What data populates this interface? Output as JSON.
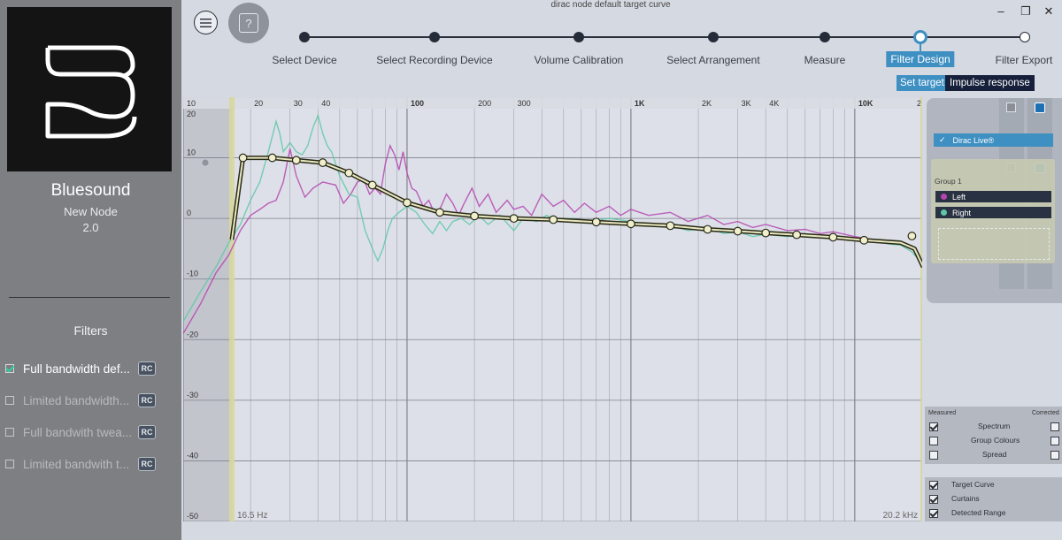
{
  "window": {
    "title": "dirac node default target curve",
    "minimize": "–",
    "restore": "❐",
    "close": "✕"
  },
  "header": {
    "help_symbol": "?",
    "menu_icon": "hamburger-icon"
  },
  "device": {
    "name": "Bluesound",
    "model": "New Node",
    "version": "2.0"
  },
  "filters": {
    "title": "Filters",
    "items": [
      {
        "label": "Full bandwidth def...",
        "checked": true,
        "badge": "RC"
      },
      {
        "label": "Limited bandwidth...",
        "checked": false,
        "badge": "RC"
      },
      {
        "label": "Full bandwith twea...",
        "checked": false,
        "badge": "RC"
      },
      {
        "label": "Limited bandwith t...",
        "checked": false,
        "badge": "RC"
      }
    ]
  },
  "wizard": {
    "steps": [
      {
        "label": "Select Device",
        "state": "done"
      },
      {
        "label": "Select Recording Device",
        "state": "done"
      },
      {
        "label": "Volume Calibration",
        "state": "done"
      },
      {
        "label": "Select Arrangement",
        "state": "done"
      },
      {
        "label": "Measure",
        "state": "done"
      },
      {
        "label": "Filter Design",
        "state": "current"
      },
      {
        "label": "Filter Export",
        "state": "future"
      }
    ]
  },
  "tabs": {
    "set_target": "Set target",
    "impulse_response": "Impulse response"
  },
  "chart_data": {
    "type": "line",
    "xscale": "log",
    "xlim": [
      10,
      20000
    ],
    "ylim": [
      -50,
      20
    ],
    "x_ticks": [
      {
        "value": 10,
        "label": "10"
      },
      {
        "value": 20,
        "label": "20"
      },
      {
        "value": 30,
        "label": "30"
      },
      {
        "value": 40,
        "label": "40"
      },
      {
        "value": 100,
        "label": "100"
      },
      {
        "value": 200,
        "label": "200"
      },
      {
        "value": 300,
        "label": "300"
      },
      {
        "value": 1000,
        "label": "1K"
      },
      {
        "value": 2000,
        "label": "2K"
      },
      {
        "value": 3000,
        "label": "3K"
      },
      {
        "value": 4000,
        "label": "4K"
      },
      {
        "value": 10000,
        "label": "10K"
      },
      {
        "value": 20000,
        "label": "2"
      }
    ],
    "y_ticks": [
      20,
      10,
      0,
      -10,
      -20,
      -30,
      -40,
      -50
    ],
    "curtains": {
      "low_hz": 16.5,
      "high_hz": 20200,
      "low_label": "16.5 Hz",
      "high_label": "20.2 kHz"
    },
    "target_curve": {
      "name": "Target Curve",
      "color": "#2a2a18",
      "points": [
        [
          16.5,
          -3.5
        ],
        [
          18.5,
          10
        ],
        [
          25,
          10
        ],
        [
          32,
          9.6
        ],
        [
          42,
          9.2
        ],
        [
          55,
          7.5
        ],
        [
          70,
          5.5
        ],
        [
          100,
          2.6
        ],
        [
          140,
          1.0
        ],
        [
          200,
          0.4
        ],
        [
          300,
          0.0
        ],
        [
          450,
          -0.2
        ],
        [
          700,
          -0.6
        ],
        [
          1000,
          -0.9
        ],
        [
          1500,
          -1.2
        ],
        [
          2200,
          -1.8
        ],
        [
          3000,
          -2.1
        ],
        [
          4000,
          -2.4
        ],
        [
          5500,
          -2.7
        ],
        [
          8000,
          -3.1
        ],
        [
          11000,
          -3.6
        ],
        [
          16000,
          -4.0
        ],
        [
          18500,
          -5.0
        ],
        [
          20200,
          -8
        ]
      ],
      "handles": [
        [
          18.5,
          10
        ],
        [
          25,
          10
        ],
        [
          32,
          9.6
        ],
        [
          42,
          9.2
        ],
        [
          55,
          7.5
        ],
        [
          70,
          5.5
        ],
        [
          100,
          2.6
        ],
        [
          140,
          1.0
        ],
        [
          200,
          0.4
        ],
        [
          300,
          0.0
        ],
        [
          450,
          -0.2
        ],
        [
          700,
          -0.6
        ],
        [
          1000,
          -0.9
        ],
        [
          1500,
          -1.2
        ],
        [
          2200,
          -1.8
        ],
        [
          3000,
          -2.1
        ],
        [
          4000,
          -2.4
        ],
        [
          5500,
          -2.7
        ],
        [
          8000,
          -3.1
        ],
        [
          11000,
          -3.6
        ],
        [
          18000,
          -2.9
        ]
      ]
    },
    "series": [
      {
        "name": "Left",
        "color": "#b545b0",
        "points": [
          [
            10,
            -19
          ],
          [
            12,
            -14
          ],
          [
            14,
            -9
          ],
          [
            16,
            -6
          ],
          [
            18,
            -2
          ],
          [
            20,
            0.5
          ],
          [
            22,
            1.5
          ],
          [
            24,
            2.5
          ],
          [
            26,
            3
          ],
          [
            28,
            6
          ],
          [
            30,
            11.5
          ],
          [
            32,
            7
          ],
          [
            35,
            3.5
          ],
          [
            38,
            5
          ],
          [
            42,
            6
          ],
          [
            48,
            5.5
          ],
          [
            52,
            2.5
          ],
          [
            56,
            4
          ],
          [
            60,
            6
          ],
          [
            64,
            6.5
          ],
          [
            68,
            4
          ],
          [
            72,
            5
          ],
          [
            76,
            4
          ],
          [
            80,
            9
          ],
          [
            84,
            12
          ],
          [
            88,
            10.5
          ],
          [
            92,
            8
          ],
          [
            96,
            11
          ],
          [
            100,
            7.5
          ],
          [
            105,
            5
          ],
          [
            110,
            4.5
          ],
          [
            118,
            2
          ],
          [
            125,
            3
          ],
          [
            132,
            1
          ],
          [
            140,
            1.5
          ],
          [
            150,
            4
          ],
          [
            160,
            2.5
          ],
          [
            170,
            0.5
          ],
          [
            180,
            2.5
          ],
          [
            195,
            5
          ],
          [
            210,
            2
          ],
          [
            230,
            4
          ],
          [
            250,
            1
          ],
          [
            280,
            3
          ],
          [
            300,
            1.5
          ],
          [
            330,
            2
          ],
          [
            360,
            0.5
          ],
          [
            400,
            4
          ],
          [
            450,
            2
          ],
          [
            500,
            3
          ],
          [
            560,
            1
          ],
          [
            620,
            2.5
          ],
          [
            700,
            1
          ],
          [
            800,
            2
          ],
          [
            900,
            0.5
          ],
          [
            1000,
            1.5
          ],
          [
            1200,
            0.5
          ],
          [
            1500,
            1
          ],
          [
            1800,
            -0.5
          ],
          [
            2200,
            0.5
          ],
          [
            2600,
            -1
          ],
          [
            3000,
            -0.5
          ],
          [
            3500,
            -1.5
          ],
          [
            4000,
            -1
          ],
          [
            5000,
            -2
          ],
          [
            6000,
            -1.8
          ],
          [
            7000,
            -2.5
          ],
          [
            8000,
            -2.2
          ],
          [
            10000,
            -3
          ],
          [
            12000,
            -3.5
          ],
          [
            14000,
            -4
          ],
          [
            16000,
            -4.3
          ],
          [
            18000,
            -5
          ],
          [
            20000,
            -7
          ]
        ]
      },
      {
        "name": "Right",
        "color": "#5fc8a8",
        "points": [
          [
            10,
            -17
          ],
          [
            12,
            -12
          ],
          [
            14,
            -8
          ],
          [
            16,
            -4
          ],
          [
            18,
            -1
          ],
          [
            20,
            3
          ],
          [
            22,
            6
          ],
          [
            24,
            11
          ],
          [
            26,
            16
          ],
          [
            27,
            14
          ],
          [
            28,
            11
          ],
          [
            30,
            12.5
          ],
          [
            32,
            11
          ],
          [
            34,
            10.5
          ],
          [
            36,
            12
          ],
          [
            38,
            15
          ],
          [
            40,
            17
          ],
          [
            42,
            14
          ],
          [
            44,
            12
          ],
          [
            46,
            11
          ],
          [
            48,
            9
          ],
          [
            50,
            7
          ],
          [
            55,
            4
          ],
          [
            60,
            3.5
          ],
          [
            65,
            -2
          ],
          [
            70,
            -5
          ],
          [
            74,
            -7
          ],
          [
            78,
            -5
          ],
          [
            82,
            -2
          ],
          [
            86,
            0
          ],
          [
            92,
            1
          ],
          [
            100,
            2
          ],
          [
            110,
            1
          ],
          [
            120,
            -1
          ],
          [
            130,
            -2.5
          ],
          [
            140,
            -0.5
          ],
          [
            150,
            -2
          ],
          [
            160,
            -0.5
          ],
          [
            175,
            0
          ],
          [
            190,
            -1
          ],
          [
            210,
            0.5
          ],
          [
            230,
            -1
          ],
          [
            260,
            0.5
          ],
          [
            300,
            -2
          ],
          [
            330,
            0
          ],
          [
            380,
            -0.5
          ],
          [
            420,
            0.5
          ],
          [
            480,
            -0.5
          ],
          [
            550,
            0
          ],
          [
            650,
            -0.5
          ],
          [
            800,
            0
          ],
          [
            1000,
            -0.5
          ],
          [
            1200,
            -1
          ],
          [
            1500,
            -1
          ],
          [
            1800,
            -2
          ],
          [
            2200,
            -1.5
          ],
          [
            2600,
            -2.5
          ],
          [
            3000,
            -2.2
          ],
          [
            3500,
            -3
          ],
          [
            4000,
            -2.6
          ],
          [
            5000,
            -3
          ],
          [
            6000,
            -2.6
          ],
          [
            7000,
            -3.2
          ],
          [
            8000,
            -3
          ],
          [
            10000,
            -3.6
          ],
          [
            12000,
            -3.4
          ],
          [
            14000,
            -4.2
          ],
          [
            16000,
            -4.4
          ],
          [
            18000,
            -5.5
          ],
          [
            20000,
            -7.5
          ]
        ]
      }
    ]
  },
  "panel": {
    "dirac_live": "Dirac Live®",
    "group": "Group 1",
    "channels": [
      {
        "label": "Left",
        "color": "#b545b0"
      },
      {
        "label": "Right",
        "color": "#5fc8a8"
      }
    ],
    "header_measured": "Measured",
    "header_corrected": "Corrected",
    "options": [
      {
        "label": "Spectrum",
        "measured": true,
        "corrected": false
      },
      {
        "label": "Group Colours",
        "measured": false,
        "corrected": false
      },
      {
        "label": "Spread",
        "measured": false,
        "corrected": false
      }
    ],
    "legend": [
      {
        "label": "Target Curve",
        "checked": true
      },
      {
        "label": "Curtains",
        "checked": true
      },
      {
        "label": "Detected Range",
        "checked": true
      }
    ]
  }
}
